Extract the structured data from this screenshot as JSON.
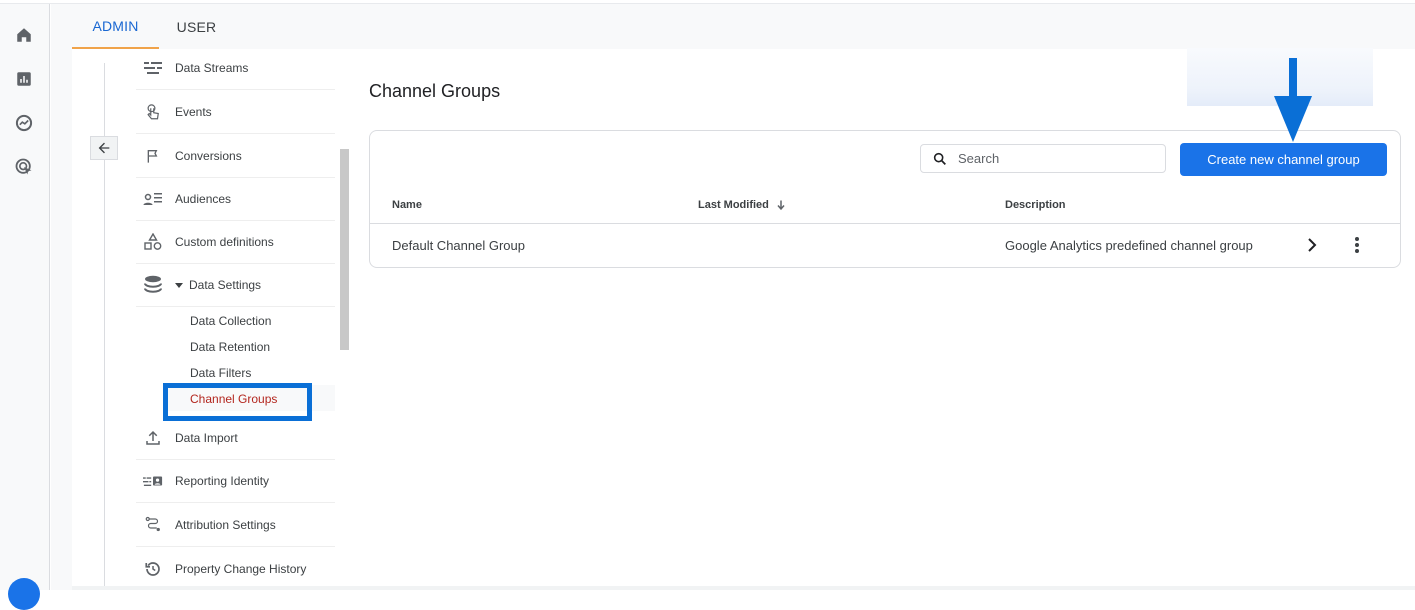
{
  "rail": {
    "icons": [
      "home-icon",
      "reports-icon",
      "explore-icon",
      "advertising-icon",
      "admin-gear-icon"
    ]
  },
  "tabs": [
    {
      "label": "ADMIN",
      "active": true
    },
    {
      "label": "USER",
      "active": false
    }
  ],
  "nav": {
    "back_icon": "arrow-left-icon",
    "items": [
      {
        "label": "Data Streams",
        "icon": "data-streams-icon"
      },
      {
        "label": "Events",
        "icon": "touch-icon"
      },
      {
        "label": "Conversions",
        "icon": "flag-icon"
      },
      {
        "label": "Audiences",
        "icon": "audiences-icon"
      },
      {
        "label": "Custom definitions",
        "icon": "shapes-icon"
      },
      {
        "label": "Data Settings",
        "icon": "database-icon",
        "expanded": true
      },
      {
        "label": "Data Import",
        "icon": "upload-icon"
      },
      {
        "label": "Reporting Identity",
        "icon": "reporting-identity-icon"
      },
      {
        "label": "Attribution Settings",
        "icon": "attribution-icon"
      },
      {
        "label": "Property Change History",
        "icon": "history-icon"
      }
    ],
    "data_settings_children": [
      {
        "label": "Data Collection"
      },
      {
        "label": "Data Retention"
      },
      {
        "label": "Data Filters"
      },
      {
        "label": "Channel Groups",
        "active": true
      }
    ]
  },
  "main": {
    "title": "Channel Groups",
    "search": {
      "placeholder": "Search",
      "value": ""
    },
    "create_button": "Create new channel group",
    "table": {
      "columns": [
        "Name",
        "Last Modified",
        "Description"
      ],
      "sort_column": "Last Modified",
      "sort_direction": "descending",
      "rows": [
        {
          "name": "Default Channel Group",
          "last_modified": "",
          "description": "Google Analytics predefined channel group"
        }
      ]
    }
  },
  "colors": {
    "accent": "#1a73e8",
    "active_tab": "#1967d2",
    "tab_indicator": "#f0a34a",
    "active_sub_item": "#b3261e",
    "annotation": "#0a6fd6"
  }
}
